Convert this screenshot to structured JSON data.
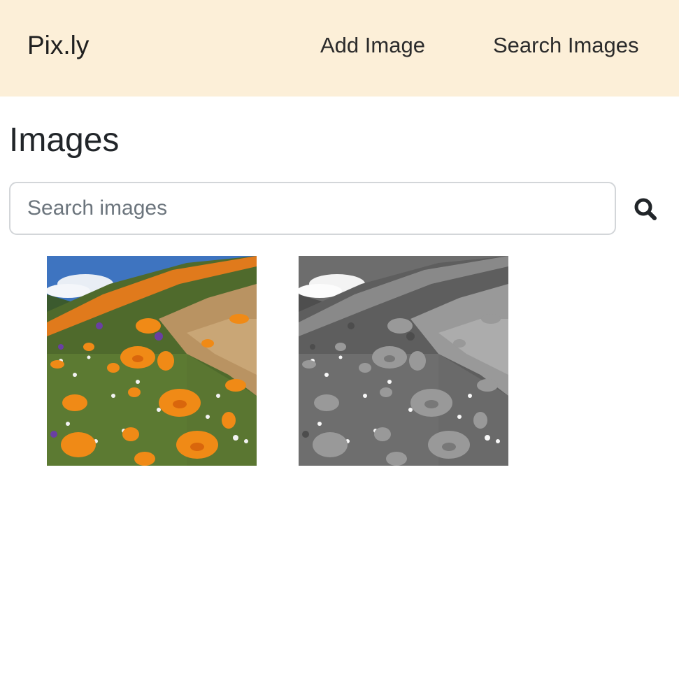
{
  "navbar": {
    "brand": "Pix.ly",
    "links": [
      {
        "label": "Add Image"
      },
      {
        "label": "Search Images"
      }
    ],
    "background_color": "#fcefd8"
  },
  "main": {
    "title": "Images",
    "search": {
      "placeholder": "Search images",
      "value": "",
      "button_icon": "search-icon"
    },
    "images": [
      {
        "description": "orange poppy wildflowers on a hillside",
        "variant": "color"
      },
      {
        "description": "orange poppy wildflowers on a hillside",
        "variant": "grayscale"
      }
    ]
  }
}
